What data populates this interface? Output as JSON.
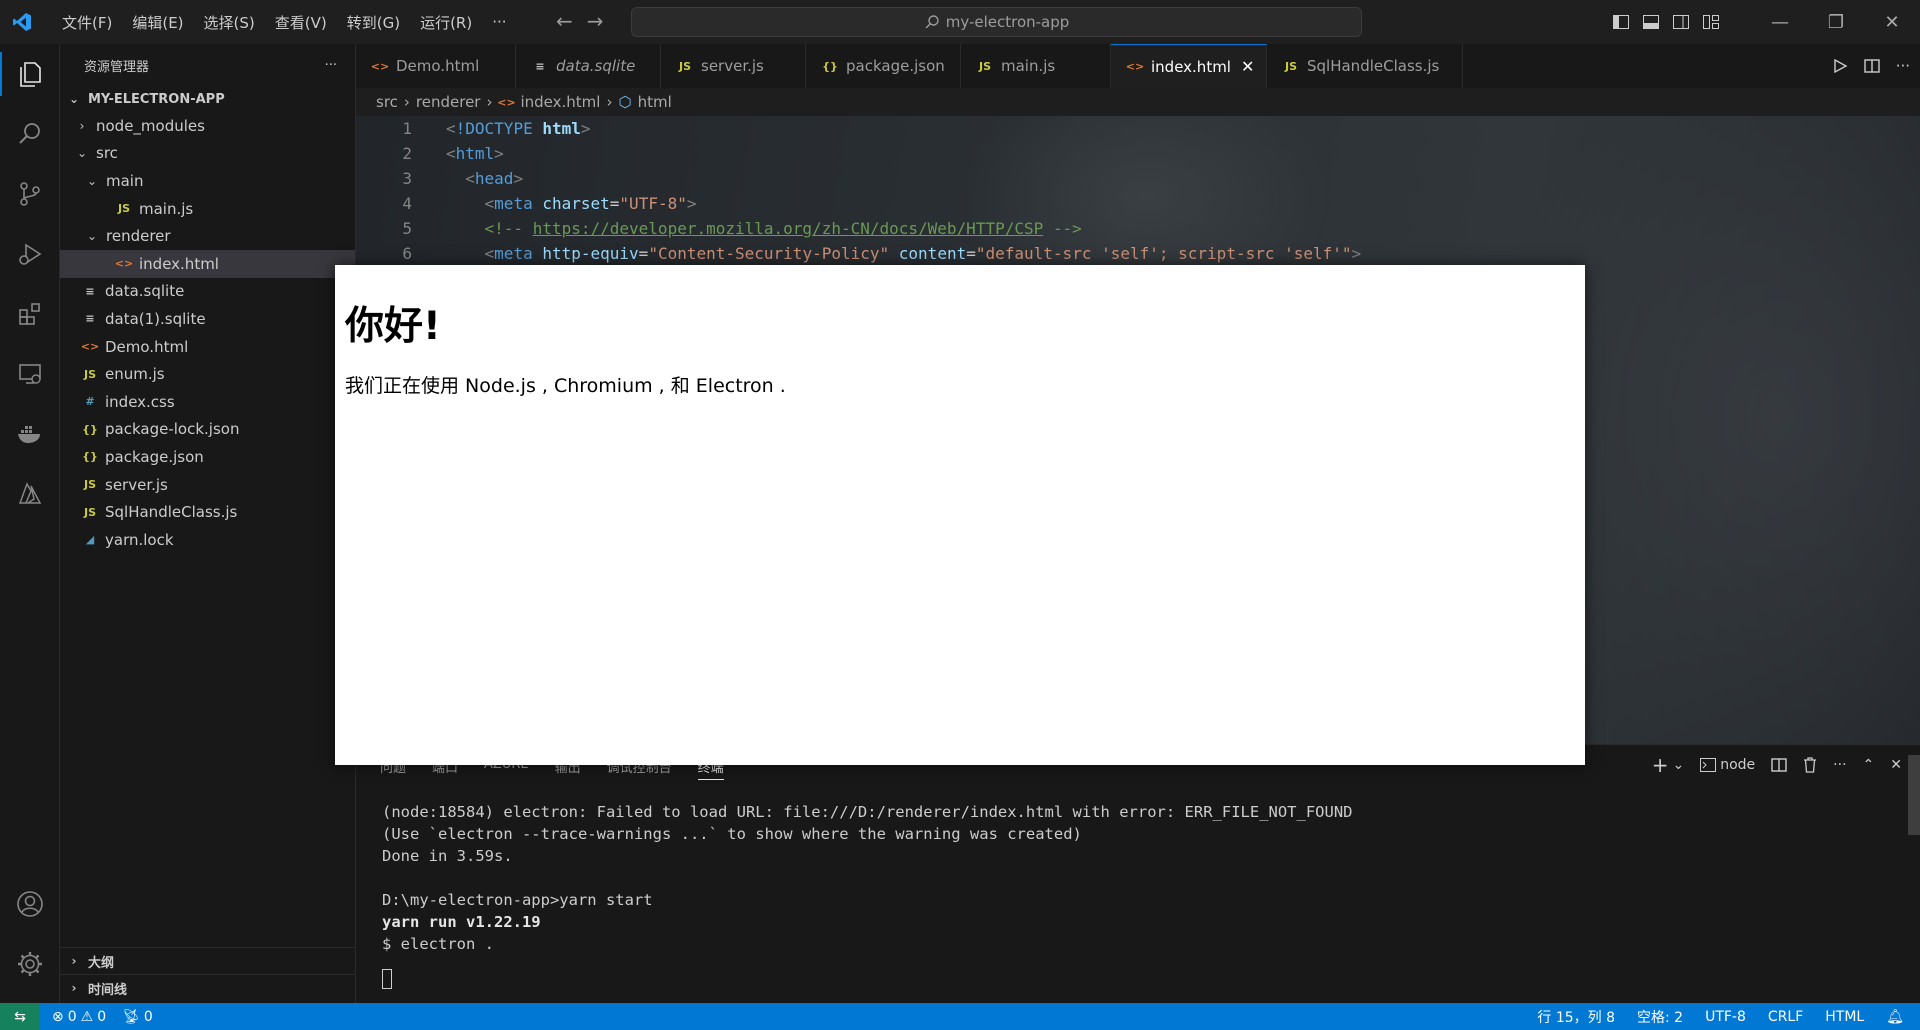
{
  "titlebar": {
    "menu": [
      "文件(F)",
      "编辑(E)",
      "选择(S)",
      "查看(V)",
      "转到(G)",
      "运行(R)",
      "···"
    ],
    "search_text": "my-electron-app"
  },
  "sidebar": {
    "title": "资源管理器",
    "more": "···",
    "root": "MY-ELECTRON-APP",
    "tree": {
      "node_modules": "node_modules",
      "src": "src",
      "main": "main",
      "main_js": "main.js",
      "renderer": "renderer",
      "index_html": "index.html",
      "data_sqlite": "data.sqlite",
      "data1_sqlite": "data(1).sqlite",
      "demo_html": "Demo.html",
      "enum_js": "enum.js",
      "index_css": "index.css",
      "package_lock": "package-lock.json",
      "package_json": "package.json",
      "server_js": "server.js",
      "sqlhandle": "SqlHandleClass.js",
      "yarn_lock": "yarn.lock"
    },
    "outline": "大纲",
    "timeline": "时间线"
  },
  "tabs": [
    {
      "label": "Demo.html"
    },
    {
      "label": "data.sqlite"
    },
    {
      "label": "server.js"
    },
    {
      "label": "package.json"
    },
    {
      "label": "main.js"
    },
    {
      "label": "index.html"
    },
    {
      "label": "SqlHandleClass.js"
    }
  ],
  "breadcrumb": {
    "a": "src",
    "b": "renderer",
    "c": "index.html",
    "d": "html"
  },
  "code": {
    "l1": {
      "num": "1",
      "kw": "!DOCTYPE",
      "tag": "html"
    },
    "l2": {
      "num": "2",
      "tag": "html"
    },
    "l3": {
      "num": "3",
      "tag": "head"
    },
    "l4": {
      "num": "4",
      "tag": "meta",
      "attr": "charset",
      "val": "\"UTF-8\""
    },
    "l5": {
      "num": "5",
      "pre": "<!-- ",
      "link": "https://developer.mozilla.org/zh-CN/docs/Web/HTTP/CSP",
      "post": " -->"
    },
    "l6": {
      "num": "6",
      "tag": "meta",
      "attr1": "http-equiv",
      "val1": "\"Content-Security-Policy\"",
      "attr2": "content",
      "val2": "\"default-src 'self'; script-src 'self'\""
    }
  },
  "panel": {
    "tabs": [
      "问题",
      "端口",
      "AZURE",
      "输出",
      "调试控制台",
      "终端"
    ],
    "terminal_label": "node",
    "lines": [
      "(node:18584) electron: Failed to load URL: file:///D:/renderer/index.html with error: ERR_FILE_NOT_FOUND",
      "(Use `electron --trace-warnings ...` to show where the warning was created)",
      "Done in 3.59s.",
      "",
      "D:\\my-electron-app>yarn start",
      "yarn run v1.22.19",
      "$ electron ."
    ]
  },
  "electron_window": {
    "heading": "你好!",
    "text": "我们正在使用 Node.js , Chromium , 和 Electron ."
  },
  "statusbar": {
    "errors": "0",
    "warnings": "0",
    "ports": "0",
    "position": "行 15，列 8",
    "spaces": "空格: 2",
    "encoding": "UTF-8",
    "eol": "CRLF",
    "language": "HTML"
  },
  "colors": {
    "accent": "#0078d4",
    "remote": "#16825d"
  }
}
